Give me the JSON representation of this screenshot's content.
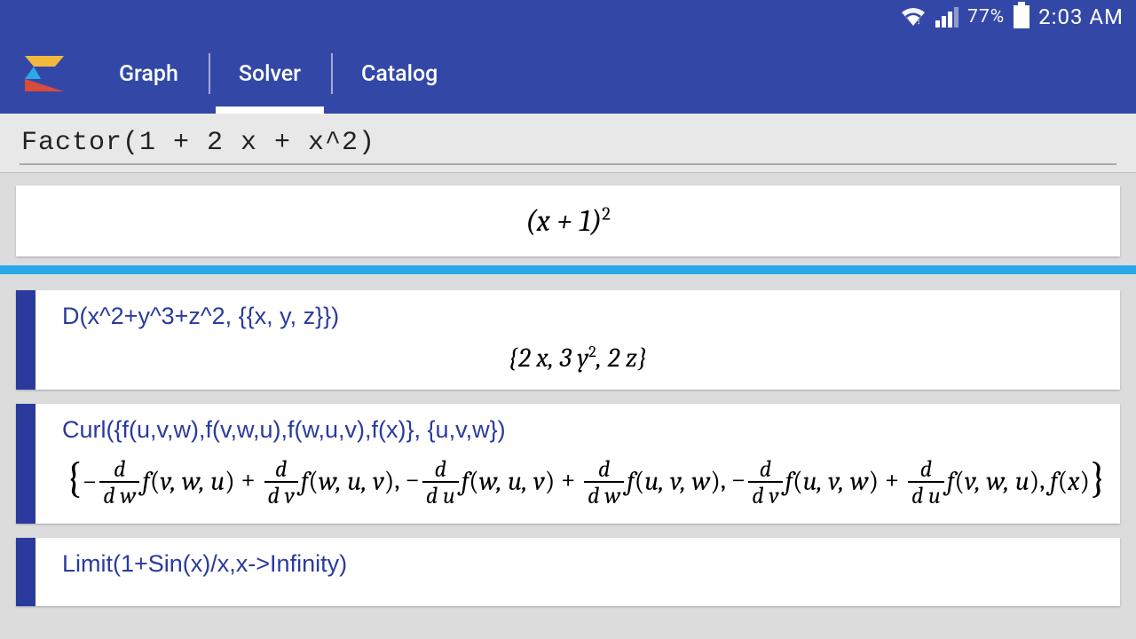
{
  "status": {
    "battery_pct": "77%",
    "time": "2:03 AM"
  },
  "tabs": {
    "graph": "Graph",
    "solver": "Solver",
    "catalog": "Catalog",
    "active": 1
  },
  "input": "Factor(1 + 2 x + x^2)",
  "main_result_html": "(<i>x</i> + 1)<sup>2</sup>",
  "history": [
    {
      "input": "D(x^2+y^3+z^2, {{x, y, z}})",
      "output_html": "{2 <i>x</i>, 3 <i>y</i><sup>2</sup>, 2 <i>z</i>}"
    },
    {
      "input": "Curl({f(u,v,w),f(v,w,u),f(w,u,v),f(x)}, {u,v,w})",
      "output_curl": true
    },
    {
      "input": "Limit(1+Sin(x)/x,x->Infinity)",
      "output_html": ""
    }
  ]
}
